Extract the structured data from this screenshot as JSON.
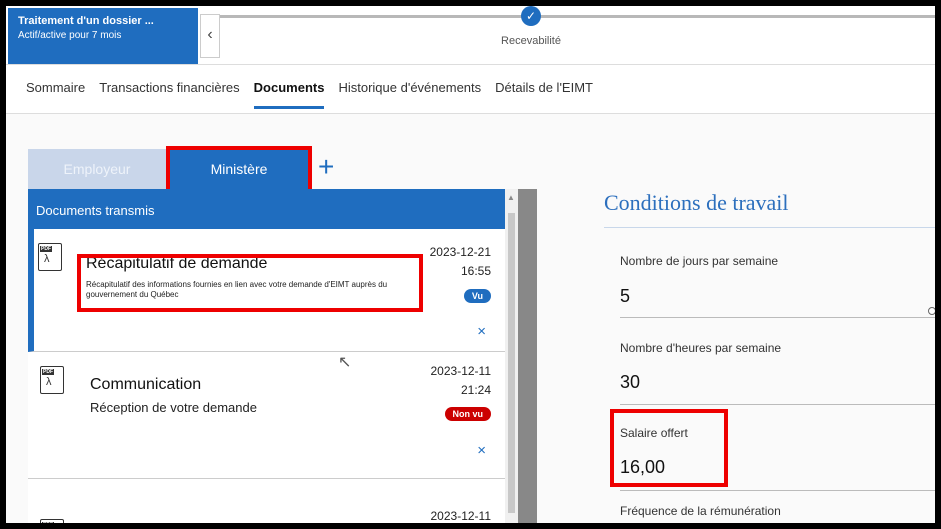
{
  "header": {
    "case_title": "Traitement d'un dossier ...",
    "case_status": "Actif/active pour 7 mois",
    "back_icon": "chevron-left-icon",
    "stage_label": "Recevabilité",
    "stage_icon": "check-icon"
  },
  "tabs": [
    {
      "label": "Sommaire",
      "active": false
    },
    {
      "label": "Transactions financières",
      "active": false
    },
    {
      "label": "Documents",
      "active": true
    },
    {
      "label": "Historique d'événements",
      "active": false
    },
    {
      "label": "Détails de l'EIMT",
      "active": false
    }
  ],
  "subtabs": {
    "employer": "Employeur",
    "ministry": "Ministère",
    "add": "+"
  },
  "documents": {
    "heading": "Documents transmis",
    "items": [
      {
        "title": "Récapitulatif de demande",
        "description": "Récapitulatif des informations fournies en lien avec votre demande d'EIMT auprès du gouvernement du Québec",
        "date": "2023-12-21",
        "time": "16:55",
        "badge": "Vu",
        "badge_status": "seen",
        "remove": "×",
        "icon": "pdf-icon"
      },
      {
        "title": "Communication",
        "description": "Réception de votre demande",
        "date": "2023-12-11",
        "time": "21:24",
        "badge": "Non vu",
        "badge_status": "unseen",
        "remove": "×",
        "icon": "pdf-icon"
      },
      {
        "date": "2023-12-11",
        "icon": "pdf-icon"
      }
    ]
  },
  "conditions": {
    "title": "Conditions de travail",
    "fields": [
      {
        "label": "Nombre de jours par semaine",
        "value": "5"
      },
      {
        "label": "Nombre d'heures par semaine",
        "value": "30"
      },
      {
        "label": "Salaire offert",
        "value": "16,00"
      },
      {
        "label": "Fréquence de la rémunération",
        "value": ""
      }
    ]
  },
  "colors": {
    "accent": "#1f6dbf",
    "highlight": "#e00000",
    "unseen_badge": "#c00000"
  }
}
